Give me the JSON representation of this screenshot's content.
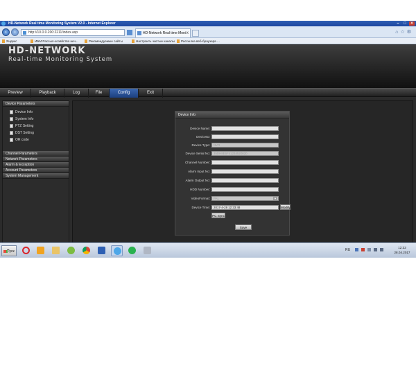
{
  "browser": {
    "title": "HD-Network Real time Monitoring System V2.0 - Internet Explorer",
    "address": "http://10.0.0.200:2211/index.asp",
    "tab_title": "HD-Network Real time Moni...",
    "tab_close": "×",
    "window_controls": [
      "–",
      "□",
      "×"
    ],
    "favorites": [
      "Яндекс",
      "ИБМ Рассыл-хозяйство неч...",
      "Рекомендуемые сайты",
      "Настроить чистые каналы",
      "Рассылка веб-браузера ..."
    ]
  },
  "app": {
    "logo": "HD-NETWORK",
    "subtitle": "Real-time Monitoring System"
  },
  "menu": [
    {
      "label": "Preview"
    },
    {
      "label": "Playback"
    },
    {
      "label": "Log"
    },
    {
      "label": "File"
    },
    {
      "label": "Config"
    },
    {
      "label": "Exit"
    }
  ],
  "sidebar": {
    "device_parameters": "Device Parameters",
    "items": [
      "Device Info",
      "System Info",
      "PTZ Setting",
      "DST Setting",
      "OR code"
    ],
    "sections": [
      "Channel Parameters",
      "Network Parameters",
      "Alarm & Exception",
      "Account Parameters",
      "System Management"
    ]
  },
  "panel": {
    "title": "Device Info",
    "fields": [
      {
        "label": "Device Name:",
        "value": ""
      },
      {
        "label": "DeviceID:",
        "value": ""
      },
      {
        "label": "Device Type:",
        "value": "NVR"
      },
      {
        "label": "Device Serial No:",
        "value": "35DH8E6F41234520820"
      },
      {
        "label": "Channel Number:",
        "value": ""
      },
      {
        "label": "Alarm Input No:",
        "value": ""
      },
      {
        "label": "Alarm Output No:",
        "value": ""
      },
      {
        "label": "HDD Number:",
        "value": ""
      }
    ],
    "video_format_label": "VideoFormat:",
    "video_format_value": "PAL",
    "device_time_label": "Device Time:",
    "device_time_value": "2017-4-28 12:33:48",
    "modify_label": "Modify",
    "pc_sync_label": "PC Sync",
    "save_label": "Save"
  },
  "taskbar": {
    "start_label": "Пуск",
    "lang": "RU",
    "clock_time": "12:32",
    "clock_date": "28.04.2017"
  }
}
